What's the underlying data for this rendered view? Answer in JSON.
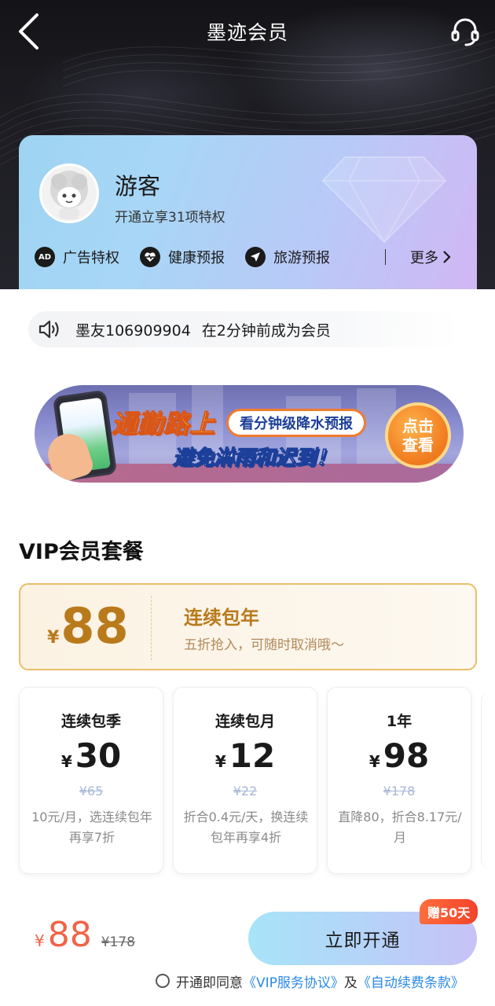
{
  "header": {
    "title": "墨迹会员",
    "back_icon": "back-arrow-icon",
    "service_icon": "headset-icon"
  },
  "member_card": {
    "user_name": "游客",
    "subtitle": "开通立享31项特权",
    "perks": [
      {
        "label": "广告特权",
        "icon": "ad-icon",
        "icon_text": "AD"
      },
      {
        "label": "健康预报",
        "icon": "heart-pulse-icon"
      },
      {
        "label": "旅游预报",
        "icon": "paper-plane-icon"
      }
    ],
    "more_label": "更多",
    "more_icon": "chevron-right-icon"
  },
  "notice": {
    "icon": "speaker-icon",
    "user": "墨友106909904",
    "text": "在2分钟前成为会员"
  },
  "banner": {
    "title1": "通勤路上",
    "pill": "看分钟级降水预报",
    "title2": "避免淋雨和迟到！",
    "cta_line1": "点击",
    "cta_line2": "查看"
  },
  "section_title": "VIP会员套餐",
  "featured_plan": {
    "currency": "¥",
    "price": "88",
    "name": "连续包年",
    "desc": "五折抢入，可随时取消哦～"
  },
  "plans": [
    {
      "name": "连续包季",
      "currency": "¥",
      "price": "30",
      "original": "¥65",
      "desc": "10元/月，选连续包年再享7折"
    },
    {
      "name": "连续包月",
      "currency": "¥",
      "price": "12",
      "original": "¥22",
      "desc": "折合0.4元/天，换连续包年再享4折"
    },
    {
      "name": "1年",
      "currency": "¥",
      "price": "98",
      "original": "¥178",
      "desc": "直降80，折合8.17元/月"
    }
  ],
  "bottom": {
    "currency": "¥",
    "price": "88",
    "original": "¥178",
    "button": "立即开通",
    "gift_badge": "赠50天",
    "agree_prefix": "开通即同意",
    "agreement1": "《VIP服务协议》",
    "agree_and": "及",
    "agreement2": "《自动续费条款》"
  },
  "colors": {
    "gold": "#b97a1c",
    "price_red": "#f06446",
    "link_blue": "#2c8ae6",
    "badge_red": "#f2422b"
  }
}
